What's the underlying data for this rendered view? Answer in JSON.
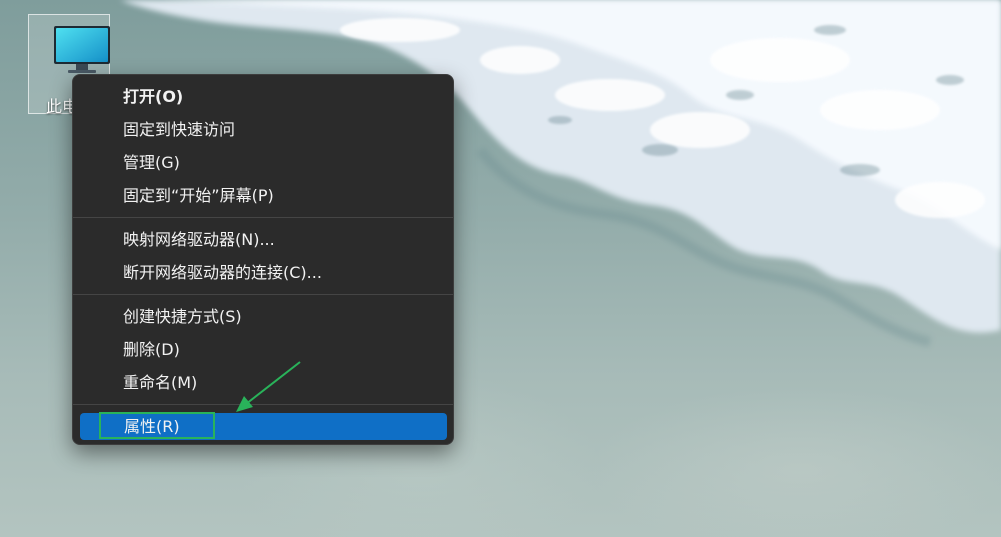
{
  "desktop": {
    "icon": {
      "label": "此电脑",
      "icon_name": "computer-monitor-icon"
    }
  },
  "context_menu": {
    "groups": [
      [
        {
          "label": "打开(O)",
          "bold": true
        },
        {
          "label": "固定到快速访问"
        },
        {
          "label": "管理(G)"
        },
        {
          "label": "固定到“开始”屏幕(P)"
        }
      ],
      [
        {
          "label": "映射网络驱动器(N)..."
        },
        {
          "label": "断开网络驱动器的连接(C)..."
        }
      ],
      [
        {
          "label": "创建快捷方式(S)"
        },
        {
          "label": "删除(D)"
        },
        {
          "label": "重命名(M)"
        }
      ],
      [
        {
          "label": "属性(R)",
          "selected": true
        }
      ]
    ]
  },
  "annotation": {
    "arrow_color": "#29b35a",
    "box_color": "#29b35a",
    "target": "属性(R)"
  },
  "colors": {
    "menu_bg": "#2b2b2b",
    "selection": "#0f6fc6",
    "text": "#f2f2f2"
  }
}
